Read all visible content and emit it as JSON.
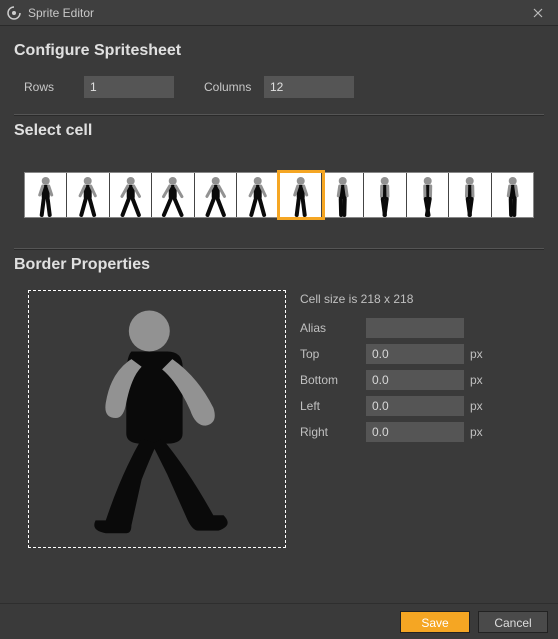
{
  "window": {
    "title": "Sprite Editor"
  },
  "configure": {
    "heading": "Configure Spritesheet",
    "rows_label": "Rows",
    "rows_value": "1",
    "cols_label": "Columns",
    "cols_value": "12"
  },
  "select": {
    "heading": "Select cell",
    "cell_count": 12,
    "selected_index": 6
  },
  "border": {
    "heading": "Border Properties",
    "cell_size_text": "Cell size is 218 x 218",
    "alias_label": "Alias",
    "alias_value": "",
    "top_label": "Top",
    "top_value": "0.0",
    "bottom_label": "Bottom",
    "bottom_value": "0.0",
    "left_label": "Left",
    "left_value": "0.0",
    "right_label": "Right",
    "right_value": "0.0",
    "unit": "px"
  },
  "footer": {
    "save": "Save",
    "cancel": "Cancel"
  }
}
